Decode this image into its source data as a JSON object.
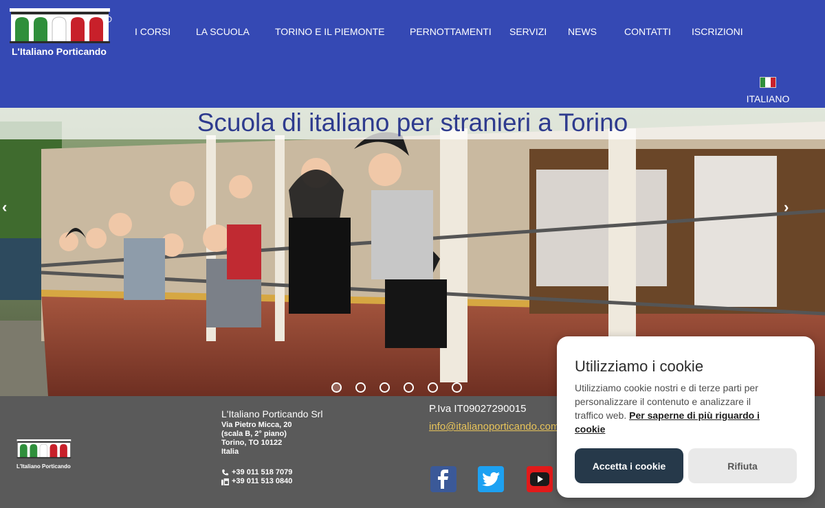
{
  "brand": {
    "logo_text": "L'Italiano Porticando",
    "footer_logo_text": "L'Italiano Porticando"
  },
  "nav": {
    "items": [
      "I CORSI",
      "LA SCUOLA",
      "TORINO E IL PIEMONTE",
      "PERNOTTAMENTI",
      "SERVIZI",
      "NEWS",
      "CONTATTI",
      "ISCRIZIONI"
    ]
  },
  "language": {
    "label": "ITALIANO"
  },
  "hero": {
    "title": "Scuola di italiano per stranieri a Torino",
    "prev": "‹",
    "next": "›",
    "slide_count": 6,
    "active_slide": 1
  },
  "footer": {
    "company_name": "L'Italiano Porticando Srl",
    "address": [
      "Via Pietro Micca, 20",
      "(scala B, 2° piano)",
      "Torino,  TO  10122",
      "Italia"
    ],
    "phone": "+39 011 518 7079",
    "fax": "+39 011 513 0840",
    "piva": "P.Iva IT09027290015",
    "email": "info@italianoporticando.com"
  },
  "cookie": {
    "title": "Utilizziamo i cookie",
    "text": "Utilizziamo cookie nostri e di terze parti per personalizzare il contenuto e analizzare il traffico web. ",
    "link": "Per saperne di più riguardo i cookie",
    "accept": "Accetta i cookie",
    "reject": "Rifiuta"
  },
  "colors": {
    "header": "#3549b4",
    "title_text": "#2e3b8e",
    "footer": "#5a5a5a",
    "email": "#e8c45a",
    "accept_button": "#26394a"
  }
}
